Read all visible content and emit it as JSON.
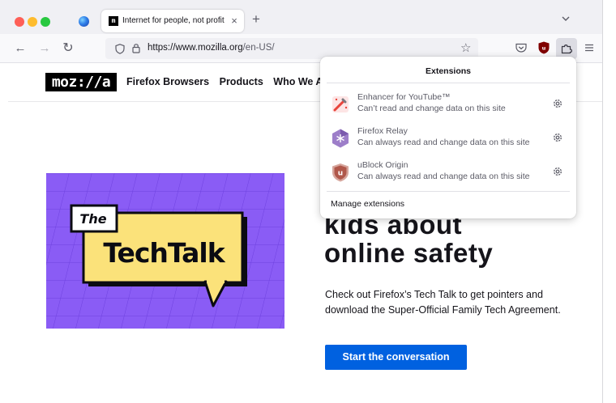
{
  "browser": {
    "tab": {
      "favicon_text": "m",
      "title": "Internet for people, not profit —",
      "close_label": "×"
    },
    "new_tab_label": "+",
    "url_host": "https://www.mozilla.org",
    "url_path": "/en-US/"
  },
  "site": {
    "logo_text": "moz://a",
    "nav": [
      "Firefox Browsers",
      "Products",
      "Who We A"
    ]
  },
  "hero": {
    "image_text_the": "The",
    "image_text_title": "TechTalk",
    "title_line1": "kids about",
    "title_line2": "online safety",
    "body": "Check out Firefox’s Tech Talk to get pointers and download the Super-Official Family Tech Agreement.",
    "cta_label": "Start the conversation"
  },
  "extensions_panel": {
    "title": "Extensions",
    "items": [
      {
        "name": "Enhancer for YouTube™",
        "access": "Can’t read and change data on this site",
        "icon": "youtube-wand-icon"
      },
      {
        "name": "Firefox Relay",
        "access": "Can always read and change data on this site",
        "icon": "relay-icon"
      },
      {
        "name": "uBlock Origin",
        "access": "Can always read and change data on this site",
        "icon": "ublock-icon"
      }
    ],
    "manage_label": "Manage extensions"
  },
  "colors": {
    "accent_button": "#0061e0",
    "hero_purple": "#8a5cf5",
    "hero_yellow": "#fbe27a"
  }
}
